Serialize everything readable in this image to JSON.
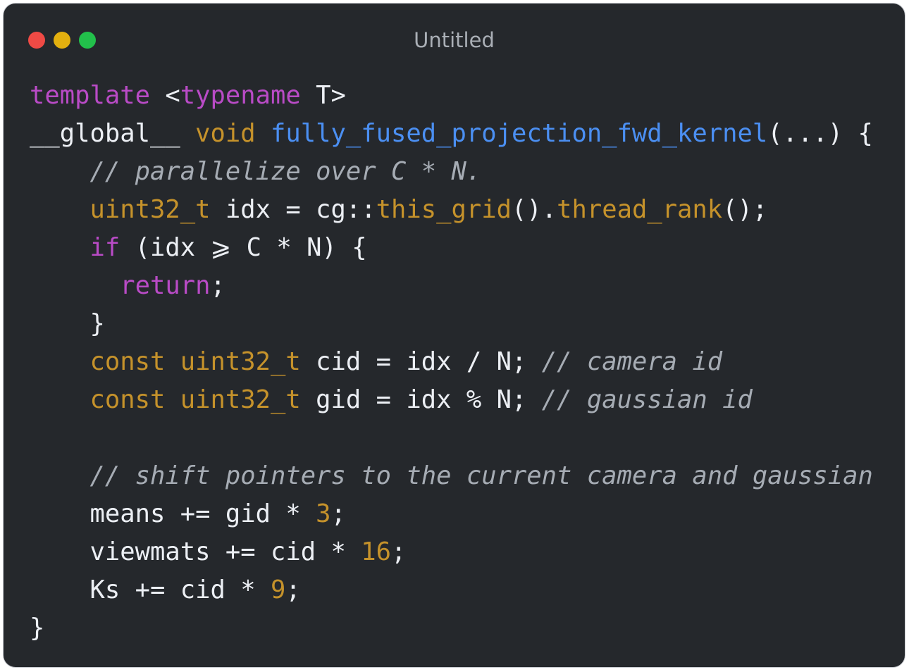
{
  "window": {
    "title": "Untitled",
    "traffic_lights": [
      {
        "name": "close",
        "color": "#ef4a45"
      },
      {
        "name": "minimize",
        "color": "#e3b00f"
      },
      {
        "name": "zoom",
        "color": "#22c04b"
      }
    ]
  },
  "theme": {
    "background": "#25282c",
    "title_color": "#aaafb6",
    "plain": "#eceff4",
    "keyword": "#b94bc6",
    "type": "#c5922b",
    "function": "#4b8ff2",
    "number": "#c5922b",
    "comment": "#a6acb4"
  },
  "code": {
    "lines": [
      {
        "indent": 0,
        "tokens": [
          {
            "t": "template",
            "k": "keyword"
          },
          {
            "t": " <",
            "k": "plain"
          },
          {
            "t": "typename",
            "k": "keyword"
          },
          {
            "t": " T>",
            "k": "plain"
          }
        ]
      },
      {
        "indent": 0,
        "tokens": [
          {
            "t": "__global__",
            "k": "plain"
          },
          {
            "t": " ",
            "k": "plain"
          },
          {
            "t": "void",
            "k": "type"
          },
          {
            "t": " ",
            "k": "plain"
          },
          {
            "t": "fully_fused_projection_fwd_kernel",
            "k": "function"
          },
          {
            "t": "(...) {",
            "k": "plain"
          }
        ]
      },
      {
        "indent": 4,
        "tokens": [
          {
            "t": "// parallelize over C * N.",
            "k": "comment"
          }
        ]
      },
      {
        "indent": 4,
        "tokens": [
          {
            "t": "uint32_t",
            "k": "type"
          },
          {
            "t": " idx = cg::",
            "k": "plain"
          },
          {
            "t": "this_grid",
            "k": "type"
          },
          {
            "t": "().",
            "k": "plain"
          },
          {
            "t": "thread_rank",
            "k": "type"
          },
          {
            "t": "();",
            "k": "plain"
          }
        ]
      },
      {
        "indent": 4,
        "tokens": [
          {
            "t": "if",
            "k": "keyword"
          },
          {
            "t": " (idx ⩾ C * N) {",
            "k": "plain"
          }
        ]
      },
      {
        "indent": 6,
        "tokens": [
          {
            "t": "return",
            "k": "keyword"
          },
          {
            "t": ";",
            "k": "plain"
          }
        ]
      },
      {
        "indent": 4,
        "tokens": [
          {
            "t": "}",
            "k": "plain"
          }
        ]
      },
      {
        "indent": 4,
        "tokens": [
          {
            "t": "const",
            "k": "type"
          },
          {
            "t": " ",
            "k": "plain"
          },
          {
            "t": "uint32_t",
            "k": "type"
          },
          {
            "t": " cid = idx / N; ",
            "k": "plain"
          },
          {
            "t": "// camera id",
            "k": "comment"
          }
        ]
      },
      {
        "indent": 4,
        "tokens": [
          {
            "t": "const",
            "k": "type"
          },
          {
            "t": " ",
            "k": "plain"
          },
          {
            "t": "uint32_t",
            "k": "type"
          },
          {
            "t": " gid = idx % N; ",
            "k": "plain"
          },
          {
            "t": "// gaussian id",
            "k": "comment"
          }
        ]
      },
      {
        "indent": 0,
        "tokens": []
      },
      {
        "indent": 4,
        "tokens": [
          {
            "t": "// shift pointers to the current camera and gaussian",
            "k": "comment"
          }
        ]
      },
      {
        "indent": 4,
        "tokens": [
          {
            "t": "means += gid * ",
            "k": "plain"
          },
          {
            "t": "3",
            "k": "number"
          },
          {
            "t": ";",
            "k": "plain"
          }
        ]
      },
      {
        "indent": 4,
        "tokens": [
          {
            "t": "viewmats += cid * ",
            "k": "plain"
          },
          {
            "t": "16",
            "k": "number"
          },
          {
            "t": ";",
            "k": "plain"
          }
        ]
      },
      {
        "indent": 4,
        "tokens": [
          {
            "t": "Ks += cid * ",
            "k": "plain"
          },
          {
            "t": "9",
            "k": "number"
          },
          {
            "t": ";",
            "k": "plain"
          }
        ]
      },
      {
        "indent": 0,
        "tokens": [
          {
            "t": "}",
            "k": "plain"
          }
        ]
      }
    ]
  }
}
